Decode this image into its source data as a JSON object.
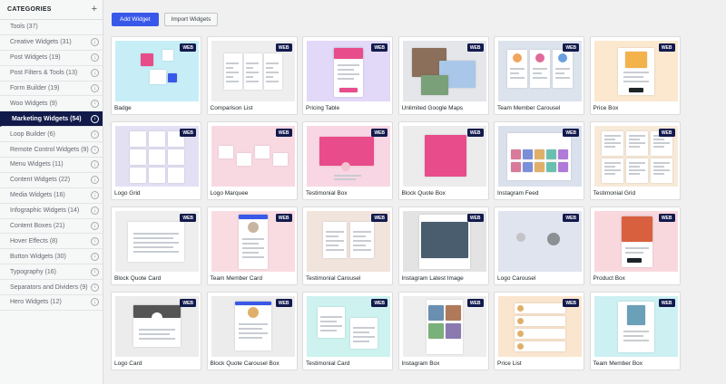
{
  "sidebar": {
    "title": "CATEGORIES",
    "add_symbol": "+",
    "download_symbol": "↓",
    "items": [
      {
        "label": "Tools (37)",
        "active": false,
        "download": false
      },
      {
        "label": "Creative Widgets (31)",
        "active": false,
        "download": true
      },
      {
        "label": "Post Widgets (19)",
        "active": false,
        "download": true
      },
      {
        "label": "Post Filters & Tools (13)",
        "active": false,
        "download": true
      },
      {
        "label": "Form Builder (19)",
        "active": false,
        "download": true
      },
      {
        "label": "Woo Widgets (9)",
        "active": false,
        "download": true
      },
      {
        "label": "Marketing Widgets (54)",
        "active": true,
        "download": true
      },
      {
        "label": "Loop Builder (6)",
        "active": false,
        "download": true
      },
      {
        "label": "Remote Control Widgets (9)",
        "active": false,
        "download": true
      },
      {
        "label": "Menu Widgets (11)",
        "active": false,
        "download": true
      },
      {
        "label": "Content Widgets (22)",
        "active": false,
        "download": true
      },
      {
        "label": "Media Widgets (16)",
        "active": false,
        "download": true
      },
      {
        "label": "Infographic Widgets (14)",
        "active": false,
        "download": true
      },
      {
        "label": "Content Boxes (21)",
        "active": false,
        "download": true
      },
      {
        "label": "Hover Effects (8)",
        "active": false,
        "download": true
      },
      {
        "label": "Button Widgets (30)",
        "active": false,
        "download": true
      },
      {
        "label": "Typography (16)",
        "active": false,
        "download": true
      },
      {
        "label": "Separators and Dividers (9)",
        "active": false,
        "download": true
      },
      {
        "label": "Hero Widgets (12)",
        "active": false,
        "download": true
      }
    ]
  },
  "toolbar": {
    "add_label": "Add Widget",
    "import_label": "Import Widgets"
  },
  "badge_text": "WEB",
  "widgets": [
    {
      "label": "Badge",
      "bg": "#c7eef7"
    },
    {
      "label": "Comparison List",
      "bg": "#eeeeee"
    },
    {
      "label": "Pricing Table",
      "bg": "#e2d8f7"
    },
    {
      "label": "Unlimited Google Maps",
      "bg": "#e5e6ea"
    },
    {
      "label": "Team Member Carousel",
      "bg": "#dde3ec"
    },
    {
      "label": "Price Box",
      "bg": "#fbe8cf"
    },
    {
      "label": "Logo Grid",
      "bg": "#e4e0f4"
    },
    {
      "label": "Logo Marquee",
      "bg": "#f8d9e2"
    },
    {
      "label": "Testimonial Box",
      "bg": "#f9d6e3"
    },
    {
      "label": "Block Quote Box",
      "bg": "#ececec"
    },
    {
      "label": "Instagram Feed",
      "bg": "#dbe1ec"
    },
    {
      "label": "Testimonial Grid",
      "bg": "#f8ead9"
    },
    {
      "label": "Block Quote Card",
      "bg": "#eeeeee"
    },
    {
      "label": "Team Member Card",
      "bg": "#f9dce1"
    },
    {
      "label": "Testimonial Carousel",
      "bg": "#f1e4dc"
    },
    {
      "label": "Instagram Latest Image",
      "bg": "#e3e3e3"
    },
    {
      "label": "Logo Carousel",
      "bg": "#dfe4ee"
    },
    {
      "label": "Product Box",
      "bg": "#f9d8dd"
    },
    {
      "label": "Logo Card",
      "bg": "#ececec"
    },
    {
      "label": "Block Quote Carousel Box",
      "bg": "#ececec"
    },
    {
      "label": "Testimonial Card",
      "bg": "#cdf2ef"
    },
    {
      "label": "Instagram Box",
      "bg": "#eeeeee"
    },
    {
      "label": "Price List",
      "bg": "#fae5cf"
    },
    {
      "label": "Team Member Box",
      "bg": "#cdf0f2"
    }
  ]
}
